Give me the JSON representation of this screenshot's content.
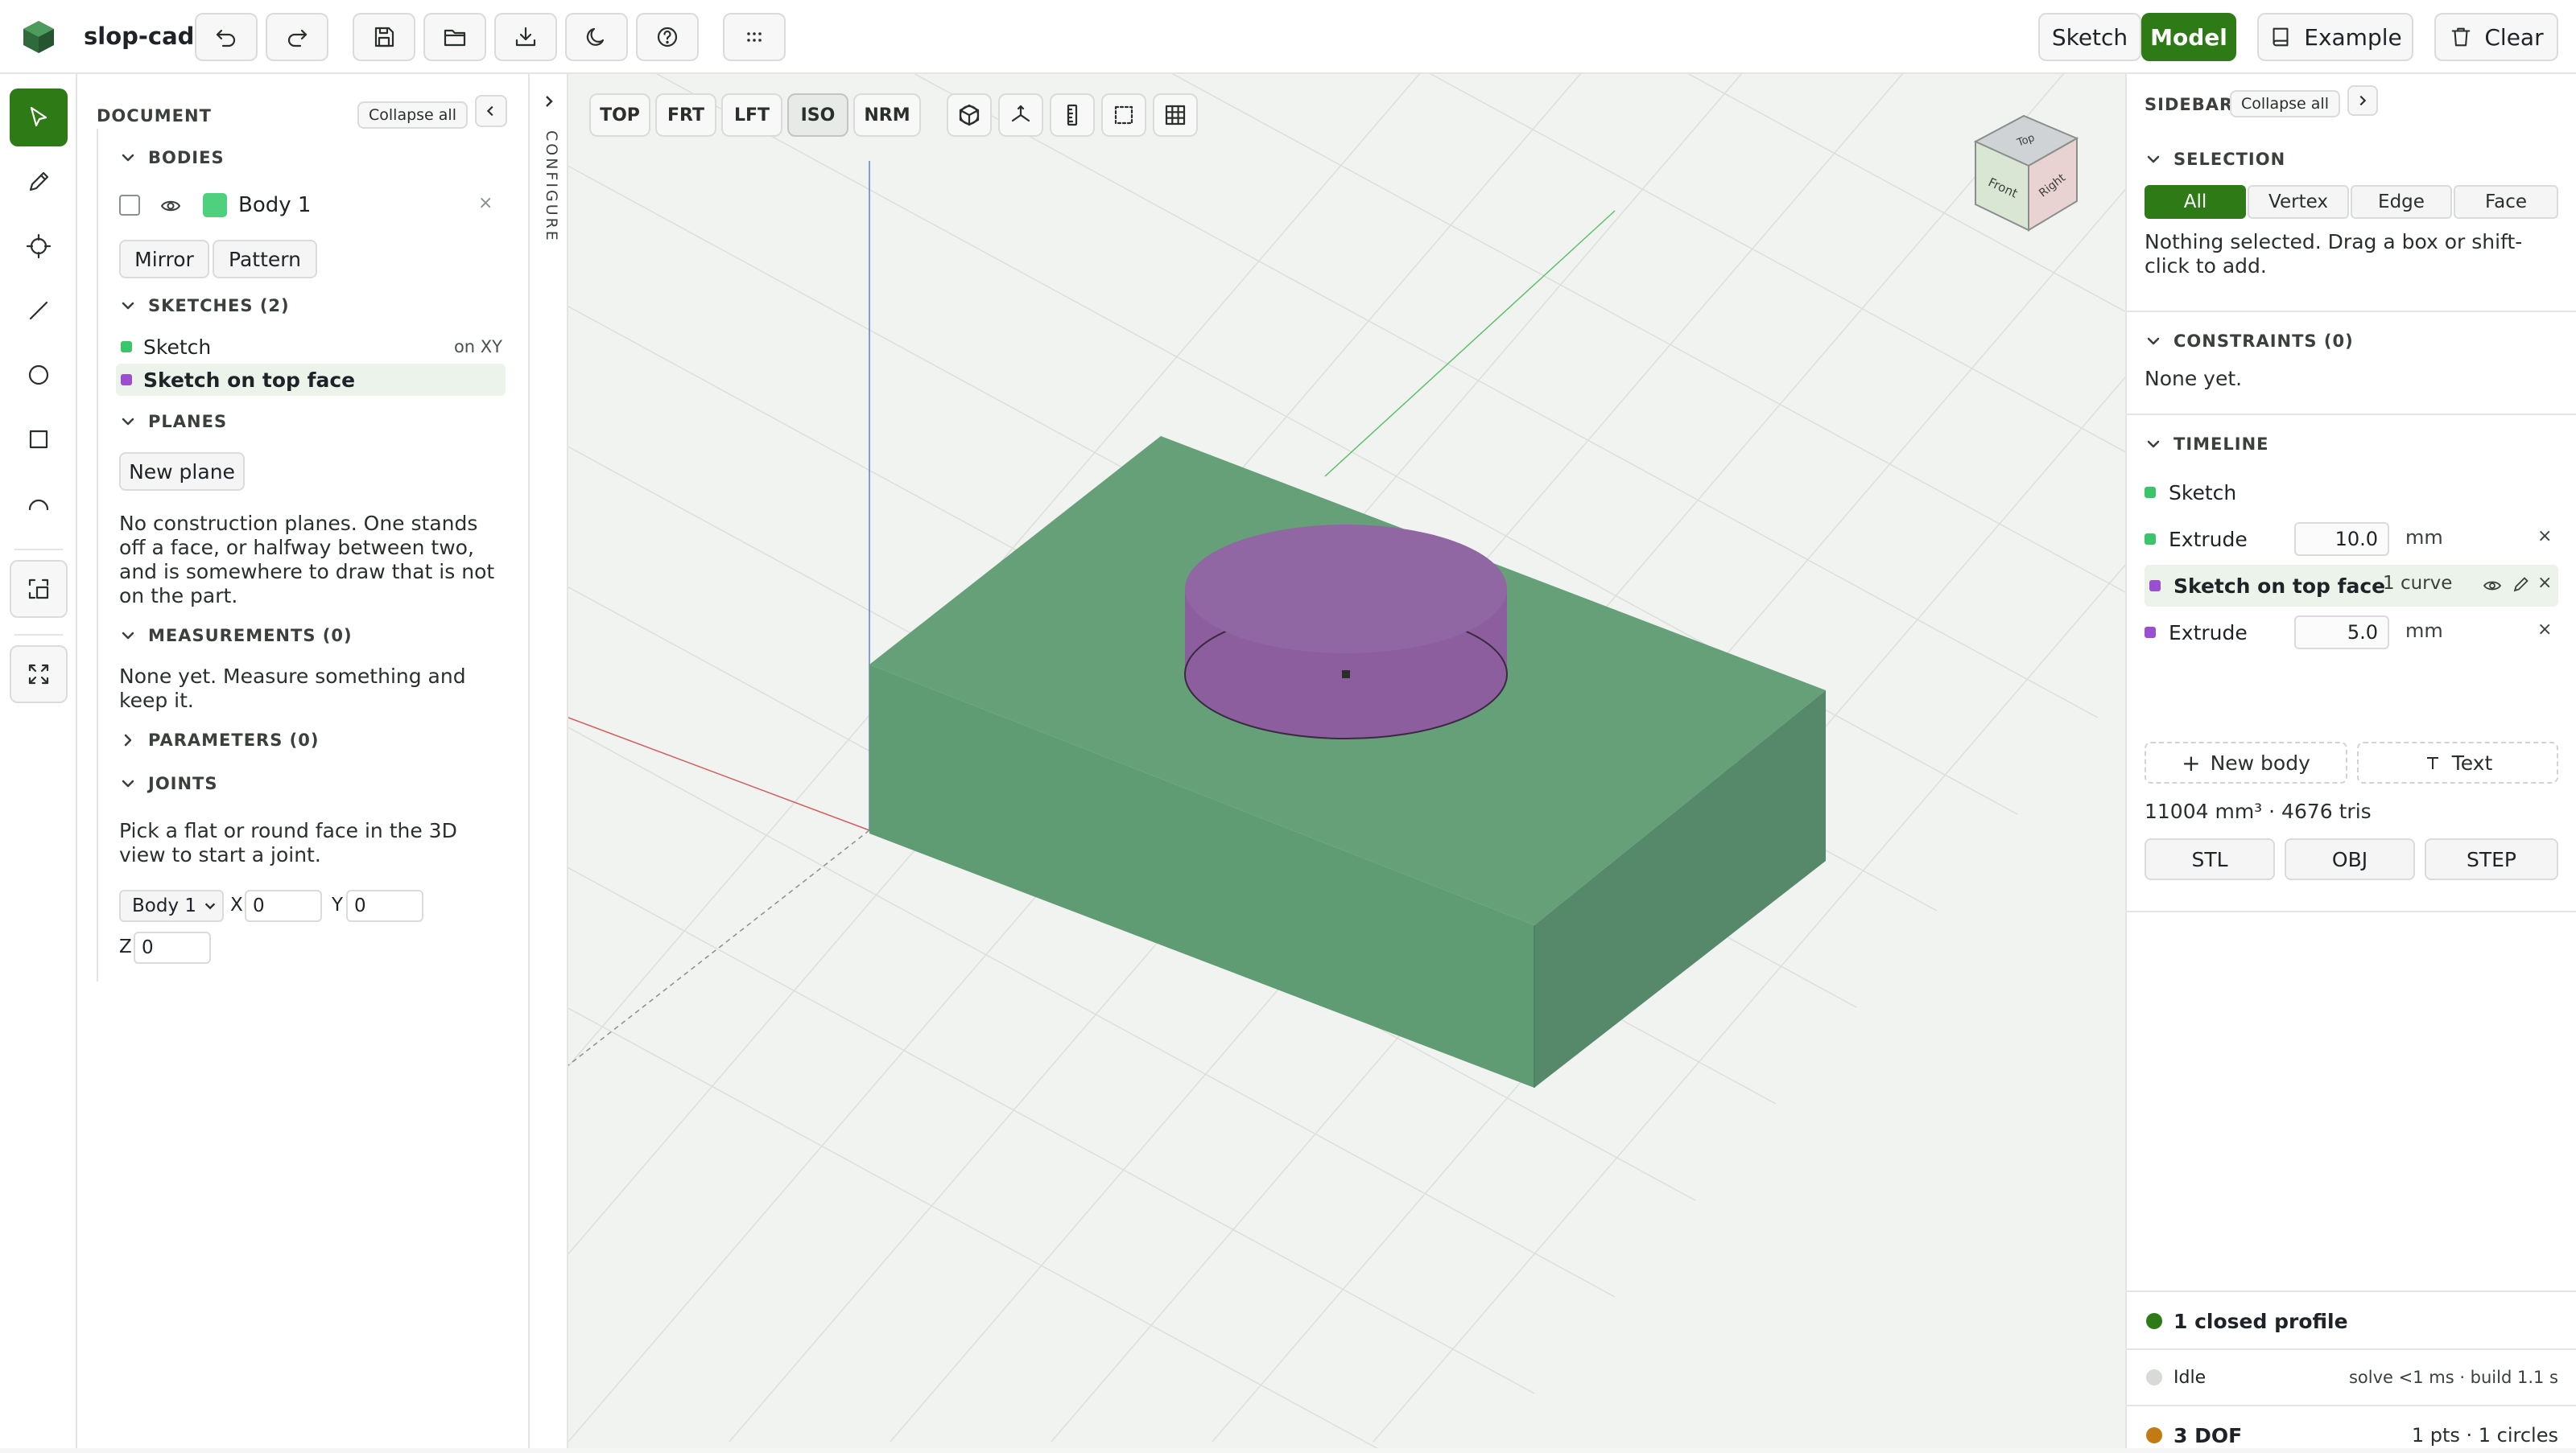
{
  "app": {
    "name": "slop-cad"
  },
  "header": {
    "mode_sketch": "Sketch",
    "mode_model": "Model",
    "example": "Example",
    "clear": "Clear"
  },
  "document": {
    "title": "DOCUMENT",
    "collapse_all": "Collapse all",
    "bodies": {
      "title": "BODIES",
      "items": [
        {
          "name": "Body 1",
          "color": "#4fd07f"
        }
      ],
      "mirror": "Mirror",
      "pattern": "Pattern"
    },
    "sketches": {
      "title": "SKETCHES (2)",
      "items": [
        {
          "name": "Sketch",
          "plane": "on XY",
          "color": "#3cc46b"
        },
        {
          "name": "Sketch on top face",
          "color": "#9a4fd0"
        }
      ]
    },
    "planes": {
      "title": "PLANES",
      "new_plane": "New plane",
      "empty": "No construction planes. One stands off a face, or halfway between two, and is somewhere to draw that is not on the part."
    },
    "measurements": {
      "title": "MEASUREMENTS (0)",
      "empty": "None yet. Measure something and keep it."
    },
    "parameters": {
      "title": "PARAMETERS (0)"
    },
    "joints": {
      "title": "JOINTS",
      "hint": "Pick a flat or round face in the 3D view to start a joint.",
      "body_select": "Body 1",
      "x_label": "X",
      "x_value": "0",
      "y_label": "Y",
      "y_value": "0",
      "z_label": "Z",
      "z_value": "0"
    }
  },
  "configure": {
    "label": "CONFIGURE"
  },
  "viewport": {
    "views": [
      "TOP",
      "FRT",
      "LFT",
      "ISO",
      "NRM"
    ],
    "active_view": "ISO",
    "cube": {
      "top": "Top",
      "front": "Front",
      "right": "Right"
    }
  },
  "sidebar": {
    "title": "SIDEBAR",
    "collapse_all": "Collapse all",
    "selection": {
      "title": "SELECTION",
      "modes": [
        "All",
        "Vertex",
        "Edge",
        "Face"
      ],
      "active": "All",
      "hint": "Nothing selected. Drag a box or shift-click to add."
    },
    "constraints": {
      "title": "CONSTRAINTS (0)",
      "empty": "None yet."
    },
    "timeline": {
      "title": "TIMELINE",
      "items": [
        {
          "name": "Sketch",
          "color": "#3cc46b"
        },
        {
          "name": "Extrude",
          "value": "10.0",
          "unit": "mm",
          "color": "#3cc46b"
        },
        {
          "name": "Sketch on top face",
          "detail": "1 curve",
          "color": "#9a4fd0"
        },
        {
          "name": "Extrude",
          "value": "5.0",
          "unit": "mm",
          "color": "#9a4fd0"
        }
      ],
      "new_body": "New body",
      "text": "Text",
      "stats": "11004 mm³ · 4676 tris",
      "exports": [
        "STL",
        "OBJ",
        "STEP"
      ]
    },
    "status": {
      "profile": "1 closed profile",
      "idle": "Idle",
      "timing": "solve <1 ms · build 1.1 s",
      "dof": "3 DOF",
      "dof_detail": "1 pts · 1 circles",
      "colors": {
        "profile": "#2d7a17",
        "idle": "#d8dad8",
        "dof": "#c47a12"
      }
    }
  }
}
